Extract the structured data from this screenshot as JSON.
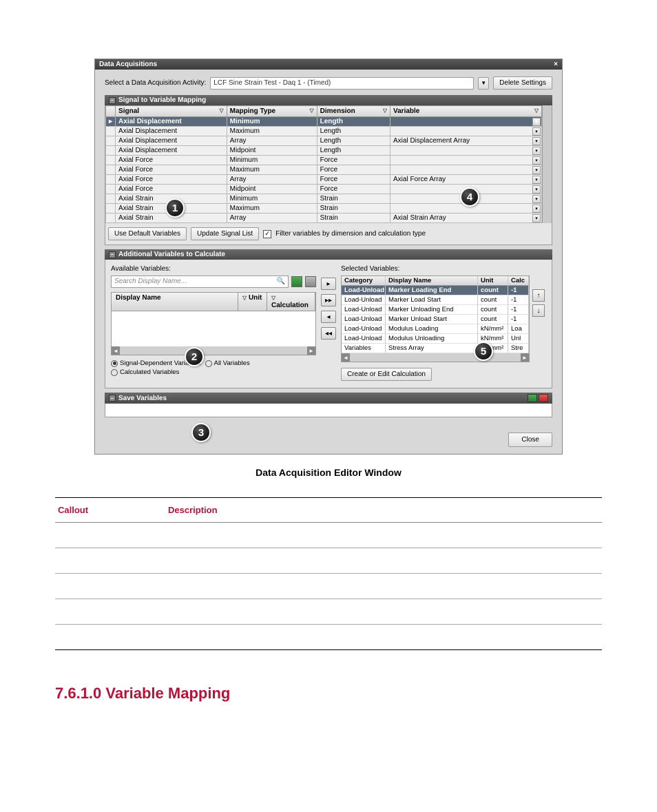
{
  "window": {
    "title": "Data Acquisitions",
    "activityLabel": "Select a Data Acquisition Activity:",
    "activityValue": "LCF Sine Strain Test - Daq 1 - (Timed)",
    "deleteSettings": "Delete Settings",
    "closeBtn": "Close"
  },
  "panels": {
    "signalMap": "Signal to Variable Mapping",
    "addVars": "Additional Variables to Calculate",
    "saveVars": "Save Variables"
  },
  "mapping": {
    "cols": {
      "signal": "Signal",
      "type": "Mapping Type",
      "dim": "Dimension",
      "var": "Variable"
    },
    "rows": [
      {
        "signal": "Axial Displacement",
        "type": "Minimum",
        "dim": "Length",
        "var": "",
        "sel": true
      },
      {
        "signal": "Axial Displacement",
        "type": "Maximum",
        "dim": "Length",
        "var": ""
      },
      {
        "signal": "Axial Displacement",
        "type": "Array",
        "dim": "Length",
        "var": "Axial Displacement Array"
      },
      {
        "signal": "Axial Displacement",
        "type": "Midpoint",
        "dim": "Length",
        "var": ""
      },
      {
        "signal": "Axial Force",
        "type": "Minimum",
        "dim": "Force",
        "var": ""
      },
      {
        "signal": "Axial Force",
        "type": "Maximum",
        "dim": "Force",
        "var": ""
      },
      {
        "signal": "Axial Force",
        "type": "Array",
        "dim": "Force",
        "var": "Axial Force Array"
      },
      {
        "signal": "Axial Force",
        "type": "Midpoint",
        "dim": "Force",
        "var": ""
      },
      {
        "signal": "Axial Strain",
        "type": "Minimum",
        "dim": "Strain",
        "var": ""
      },
      {
        "signal": "Axial Strain",
        "type": "Maximum",
        "dim": "Strain",
        "var": ""
      },
      {
        "signal": "Axial Strain",
        "type": "Array",
        "dim": "Strain",
        "var": "Axial Strain Array"
      }
    ],
    "useDefault": "Use Default Variables",
    "updateSig": "Update Signal List",
    "filterChk": "Filter variables by dimension and calculation type"
  },
  "addVars": {
    "availLabel": "Available Variables:",
    "selLabel": "Selected Variables:",
    "searchPlaceholder": "Search Display Name...",
    "availCols": {
      "name": "Display Name",
      "unit": "Unit",
      "calc": "Calculation"
    },
    "selCols": {
      "cat": "Category",
      "name": "Display Name",
      "unit": "Unit",
      "calc": "Calc"
    },
    "selRows": [
      {
        "cat": "Load-Unload",
        "name": "Marker Loading End",
        "unit": "count",
        "calc": "-1",
        "sel": true
      },
      {
        "cat": "Load-Unload",
        "name": "Marker Load Start",
        "unit": "count",
        "calc": "-1"
      },
      {
        "cat": "Load-Unload",
        "name": "Marker Unloading End",
        "unit": "count",
        "calc": "-1"
      },
      {
        "cat": "Load-Unload",
        "name": "Marker Unload Start",
        "unit": "count",
        "calc": "-1"
      },
      {
        "cat": "Load-Unload",
        "name": "Modulus Loading",
        "unit": "kN/mm²",
        "calc": "Loa"
      },
      {
        "cat": "Load-Unload",
        "name": "Modulus Unloading",
        "unit": "kN/mm²",
        "calc": "Unl"
      },
      {
        "cat": "Variables",
        "name": "Stress Array",
        "unit": "kN/mm²",
        "calc": "Stre"
      }
    ],
    "radios": {
      "sigdep": "Signal-Dependent Variables",
      "all": "All Variables",
      "calc": "Calculated Variables"
    },
    "createCalc": "Create or Edit Calculation"
  },
  "caption": "Data Acquisition Editor Window",
  "docTable": {
    "headers": {
      "callout": "Callout",
      "desc": "Description"
    }
  },
  "sectionHeading": "7.6.1.0 Variable Mapping",
  "callouts": [
    "1",
    "2",
    "3",
    "4",
    "5"
  ]
}
